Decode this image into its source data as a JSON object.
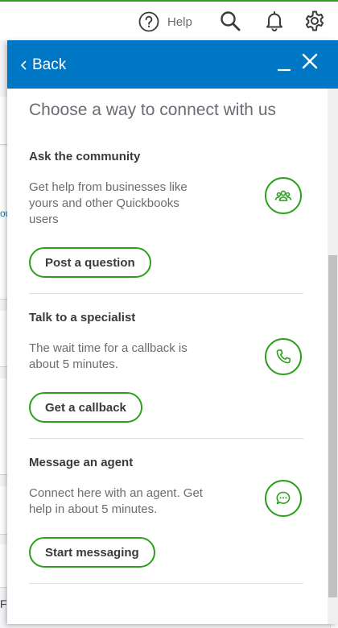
{
  "topbar": {
    "help_label": "Help",
    "icons": [
      "help-circle-icon",
      "search-icon",
      "bell-icon",
      "gear-icon"
    ]
  },
  "background": {
    "left_fragment": "ou",
    "bottom_fragment": "Fl"
  },
  "panel": {
    "back_label": "Back",
    "heading": "Choose a way to connect with us",
    "header_color": "#0077c5",
    "accent_color": "#2ca01c",
    "sections": [
      {
        "title": "Ask the community",
        "description": "Get help from businesses like yours and other Quickbooks users",
        "button_label": "Post a question",
        "icon": "community-icon"
      },
      {
        "title": "Talk to a specialist",
        "description": "The wait time for a callback is about 5 minutes.",
        "button_label": "Get a callback",
        "icon": "phone-icon"
      },
      {
        "title": "Message an agent",
        "description": "Connect here with an agent. Get help in about 5 minutes.",
        "button_label": "Start messaging",
        "icon": "chat-icon"
      }
    ]
  }
}
